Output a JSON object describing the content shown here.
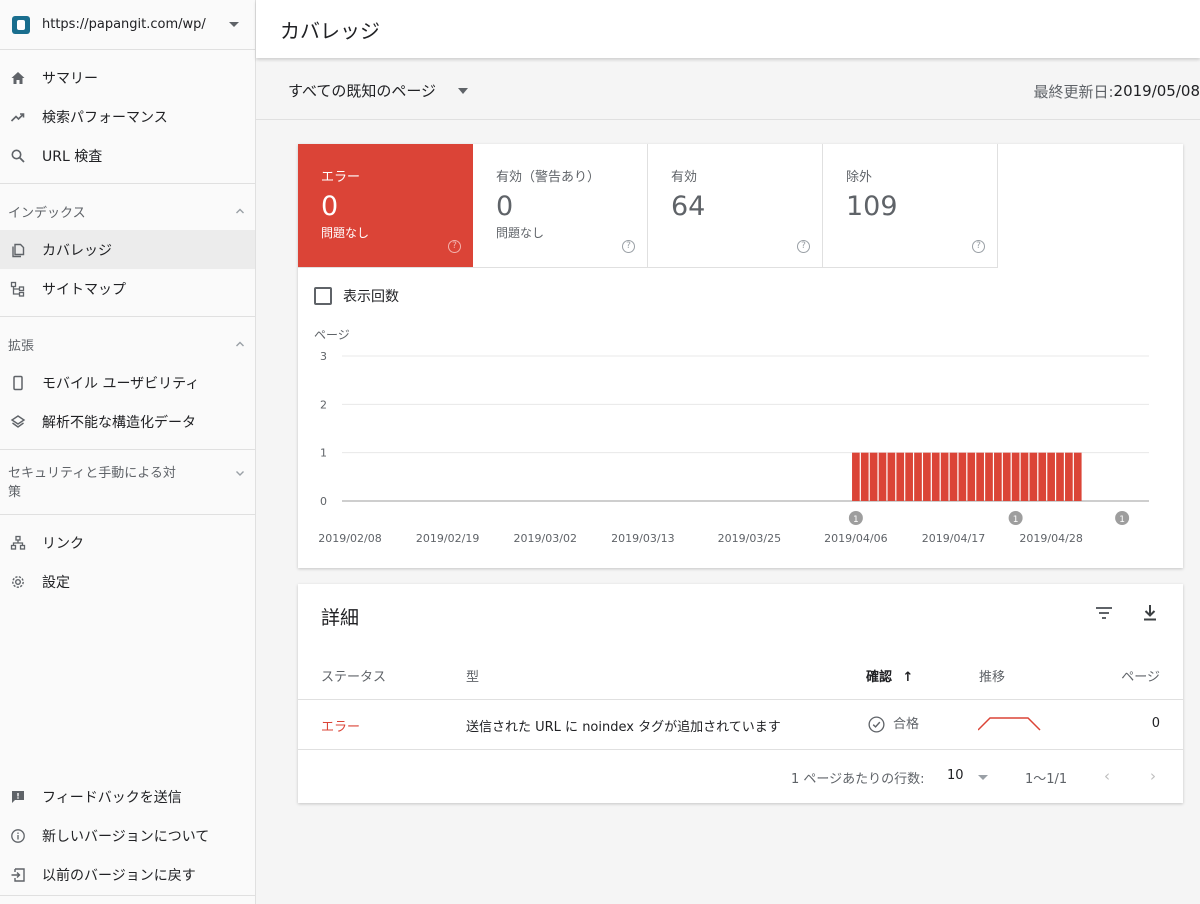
{
  "property": {
    "url": "https://papangit.com/wp/"
  },
  "nav": {
    "main": [
      {
        "label": "サマリー",
        "icon": "home-icon"
      },
      {
        "label": "検索パフォーマンス",
        "icon": "trending-up-icon"
      },
      {
        "label": "URL 検査",
        "icon": "search-icon"
      }
    ],
    "index_section": {
      "label": "インデックス",
      "items": [
        {
          "label": "カバレッジ",
          "icon": "coverage-icon",
          "active": true
        },
        {
          "label": "サイトマップ",
          "icon": "sitemap-icon"
        }
      ]
    },
    "enhance_section": {
      "label": "拡張",
      "items": [
        {
          "label": "モバイル ユーザビリティ",
          "icon": "mobile-icon"
        },
        {
          "label": "解析不能な構造化データ",
          "icon": "layers-icon"
        }
      ]
    },
    "security_section": {
      "label": "セキュリティと手動による対策"
    },
    "misc": [
      {
        "label": "リンク",
        "icon": "links-icon"
      },
      {
        "label": "設定",
        "icon": "settings-icon"
      }
    ],
    "bottom": [
      {
        "label": "フィードバックを送信",
        "icon": "feedback-icon"
      },
      {
        "label": "新しいバージョンについて",
        "icon": "info-icon"
      },
      {
        "label": "以前のバージョンに戻す",
        "icon": "exit-icon"
      }
    ]
  },
  "header": {
    "title": "カバレッジ"
  },
  "filter": {
    "label": "すべての既知のページ",
    "updated_label": "最終更新日: ",
    "updated_value": "2019/05/08"
  },
  "tiles": [
    {
      "label": "エラー",
      "value": "0",
      "sub": "問題なし"
    },
    {
      "label": "有効（警告あり）",
      "value": "0",
      "sub": "問題なし"
    },
    {
      "label": "有効",
      "value": "64",
      "sub": ""
    },
    {
      "label": "除外",
      "value": "109",
      "sub": ""
    }
  ],
  "impressions_checkbox": {
    "label": "表示回数",
    "checked": false
  },
  "chart_data": {
    "type": "bar",
    "ylabel": "ページ",
    "ylim": [
      0,
      3
    ],
    "yticks": [
      "0",
      "1",
      "2",
      "3"
    ],
    "xtick_labels": [
      "2019/02/08",
      "2019/02/19",
      "2019/03/02",
      "2019/03/13",
      "2019/03/25",
      "2019/04/06",
      "2019/04/17",
      "2019/04/28"
    ],
    "bar_color": "#db4437",
    "start_date": "2019/02/08",
    "end_date": "2019/05/07",
    "bars": {
      "from": "2019/04/06",
      "to": "2019/05/01",
      "value": 1
    },
    "annotations": [
      {
        "date": "2019/04/06",
        "label": "1"
      },
      {
        "date": "2019/04/24",
        "label": "1"
      },
      {
        "date": "2019/05/06",
        "label": "1"
      }
    ]
  },
  "details": {
    "title": "詳細",
    "columns": {
      "status": "ステータス",
      "type": "型",
      "validation": "確認",
      "trend": "推移",
      "pages": "ページ"
    },
    "rows": [
      {
        "status": "エラー",
        "type": "送信された URL に noindex タグが追加されています",
        "validation": "合格",
        "pages": "0"
      }
    ],
    "pager": {
      "rows_label": "1 ページあたりの行数:",
      "rows_value": "10",
      "range": "1〜1/1"
    }
  },
  "colors": {
    "error": "#db4437",
    "active_bg": "#ececec"
  }
}
